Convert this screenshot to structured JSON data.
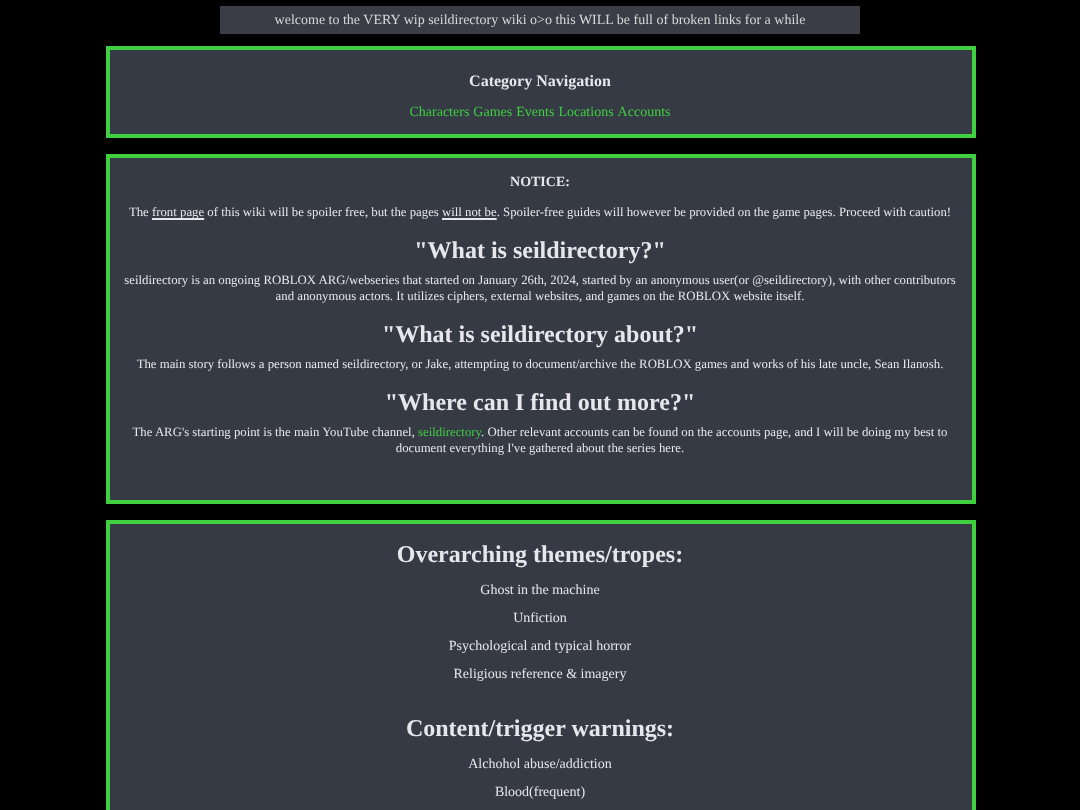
{
  "banner": "welcome to the VERY wip seildirectory wiki o>o this WILL be full of broken links for a while",
  "navigation": {
    "title": "Category Navigation",
    "links": [
      "Characters",
      "Games",
      "Events",
      "Locations",
      "Accounts"
    ]
  },
  "notice": {
    "title": "NOTICE:",
    "parts": [
      {
        "kind": "plain",
        "text": "The "
      },
      {
        "kind": "underlined",
        "text": "front page"
      },
      {
        "kind": "plain",
        "text": " of this wiki will be spoiler free, but the pages "
      },
      {
        "kind": "underlined",
        "text": "will not be"
      },
      {
        "kind": "plain",
        "text": ". Spoiler-free guides will however be provided on the game pages. Proceed with caution!"
      }
    ]
  },
  "sections": [
    {
      "heading": "\"What is seildirectory?\"",
      "parts": [
        {
          "kind": "plain",
          "text": "seildirectory is an ongoing ROBLOX ARG/webseries that started on January 26th, 2024, started by an anonymous user(or @seildirectory), with other contributors and anonymous actors. It utilizes ciphers, external websites, and games on the ROBLOX website itself."
        }
      ]
    },
    {
      "heading": "\"What is seildirectory about?\"",
      "parts": [
        {
          "kind": "plain",
          "text": "The main story follows a person named seildirectory, or Jake, attempting to document/archive the ROBLOX games and works of his late uncle, Sean Ilanosh."
        }
      ]
    },
    {
      "heading": "\"Where can I find out more?\"",
      "parts": [
        {
          "kind": "plain",
          "text": "The ARG's starting point is the main YouTube channel, "
        },
        {
          "kind": "green",
          "text": "seildirectory"
        },
        {
          "kind": "plain",
          "text": ". Other relevant accounts can be found on the accounts page, and I will be doing my best to document everything I've gathered about the series here."
        }
      ]
    }
  ],
  "lists": [
    {
      "heading": "Overarching themes/tropes:",
      "items": [
        "Ghost in the machine",
        "Unfiction",
        "Psychological and typical horror",
        "Religious reference & imagery"
      ]
    },
    {
      "heading": "Content/trigger warnings:",
      "items": [
        "Alchohol abuse/addiction",
        "Blood(frequent)"
      ]
    }
  ]
}
